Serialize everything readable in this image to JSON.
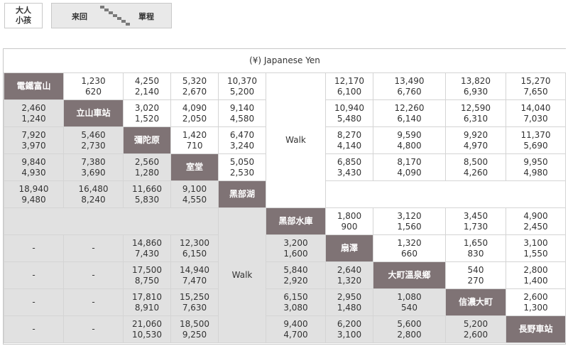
{
  "legend": {
    "adult": "大人",
    "child": "小孩",
    "round_trip": "来回",
    "one_way": "單程"
  },
  "currency": "(¥) Japanese Yen",
  "walk": "Walk",
  "dash": "-",
  "stations": {
    "s1": "電鐵富山",
    "s2": "立山車站",
    "s3": "彌陀原",
    "s4": "室堂",
    "s5": "黑部湖",
    "s6": "黑部水庫",
    "s7": "扇澤",
    "s8": "大町溫泉鄉",
    "s9": "信濃大町",
    "s10": "長野車站"
  },
  "fares": {
    "r1": {
      "c2": [
        "1,230",
        "620"
      ],
      "c3": [
        "4,250",
        "2,140"
      ],
      "c4": [
        "5,320",
        "2,670"
      ],
      "c5": [
        "10,370",
        "5,200"
      ],
      "c7": [
        "12,170",
        "6,100"
      ],
      "c8": [
        "13,490",
        "6,760"
      ],
      "c9": [
        "13,820",
        "6,930"
      ],
      "c10": [
        "15,270",
        "7,650"
      ]
    },
    "r2": {
      "c1": [
        "2,460",
        "1,240"
      ],
      "c3": [
        "3,020",
        "1,520"
      ],
      "c4": [
        "4,090",
        "2,050"
      ],
      "c5": [
        "9,140",
        "4,580"
      ],
      "c7": [
        "10,940",
        "5,480"
      ],
      "c8": [
        "12,260",
        "6,140"
      ],
      "c9": [
        "12,590",
        "6,310"
      ],
      "c10": [
        "14,040",
        "7,030"
      ]
    },
    "r3": {
      "c1": [
        "7,920",
        "3,970"
      ],
      "c2": [
        "5,460",
        "2,730"
      ],
      "c4": [
        "1,420",
        "710"
      ],
      "c5": [
        "6,470",
        "3,240"
      ],
      "c7": [
        "8,270",
        "4,140"
      ],
      "c8": [
        "9,590",
        "4,800"
      ],
      "c9": [
        "9,920",
        "4,970"
      ],
      "c10": [
        "11,370",
        "5,690"
      ]
    },
    "r4": {
      "c1": [
        "9,840",
        "4,930"
      ],
      "c2": [
        "7,380",
        "3,690"
      ],
      "c3": [
        "2,560",
        "1,280"
      ],
      "c5": [
        "5,050",
        "2,530"
      ],
      "c7": [
        "6,850",
        "3,430"
      ],
      "c8": [
        "8,170",
        "4,090"
      ],
      "c9": [
        "8,500",
        "4,260"
      ],
      "c10": [
        "9,950",
        "4,980"
      ]
    },
    "r5": {
      "c1": [
        "18,940",
        "9,480"
      ],
      "c2": [
        "16,480",
        "8,240"
      ],
      "c3": [
        "11,660",
        "5,830"
      ],
      "c4": [
        "9,100",
        "4,550"
      ]
    },
    "r6": {
      "c7": [
        "1,800",
        "900"
      ],
      "c8": [
        "3,120",
        "1,560"
      ],
      "c9": [
        "3,450",
        "1,730"
      ],
      "c10": [
        "4,900",
        "2,450"
      ]
    },
    "r7": {
      "c3": [
        "14,860",
        "7,430"
      ],
      "c4": [
        "12,300",
        "6,150"
      ],
      "c6": [
        "3,200",
        "1,600"
      ],
      "c8": [
        "1,320",
        "660"
      ],
      "c9": [
        "1,650",
        "830"
      ],
      "c10": [
        "3,100",
        "1,550"
      ]
    },
    "r8": {
      "c3": [
        "17,500",
        "8,750"
      ],
      "c4": [
        "14,940",
        "7,470"
      ],
      "c6": [
        "5,840",
        "2,920"
      ],
      "c7": [
        "2,640",
        "1,320"
      ],
      "c9": [
        "540",
        "270"
      ],
      "c10": [
        "2,800",
        "1,400"
      ]
    },
    "r9": {
      "c3": [
        "17,810",
        "8,910"
      ],
      "c4": [
        "15,250",
        "7,630"
      ],
      "c6": [
        "6,150",
        "3,080"
      ],
      "c7": [
        "2,950",
        "1,480"
      ],
      "c8": [
        "1,080",
        "540"
      ],
      "c10": [
        "2,600",
        "1,300"
      ]
    },
    "r10": {
      "c3": [
        "21,060",
        "10,530"
      ],
      "c4": [
        "18,500",
        "9,250"
      ],
      "c6": [
        "9,400",
        "4,700"
      ],
      "c7": [
        "6,200",
        "3,100"
      ],
      "c8": [
        "5,600",
        "2,800"
      ],
      "c9": [
        "5,200",
        "2,600"
      ]
    }
  }
}
